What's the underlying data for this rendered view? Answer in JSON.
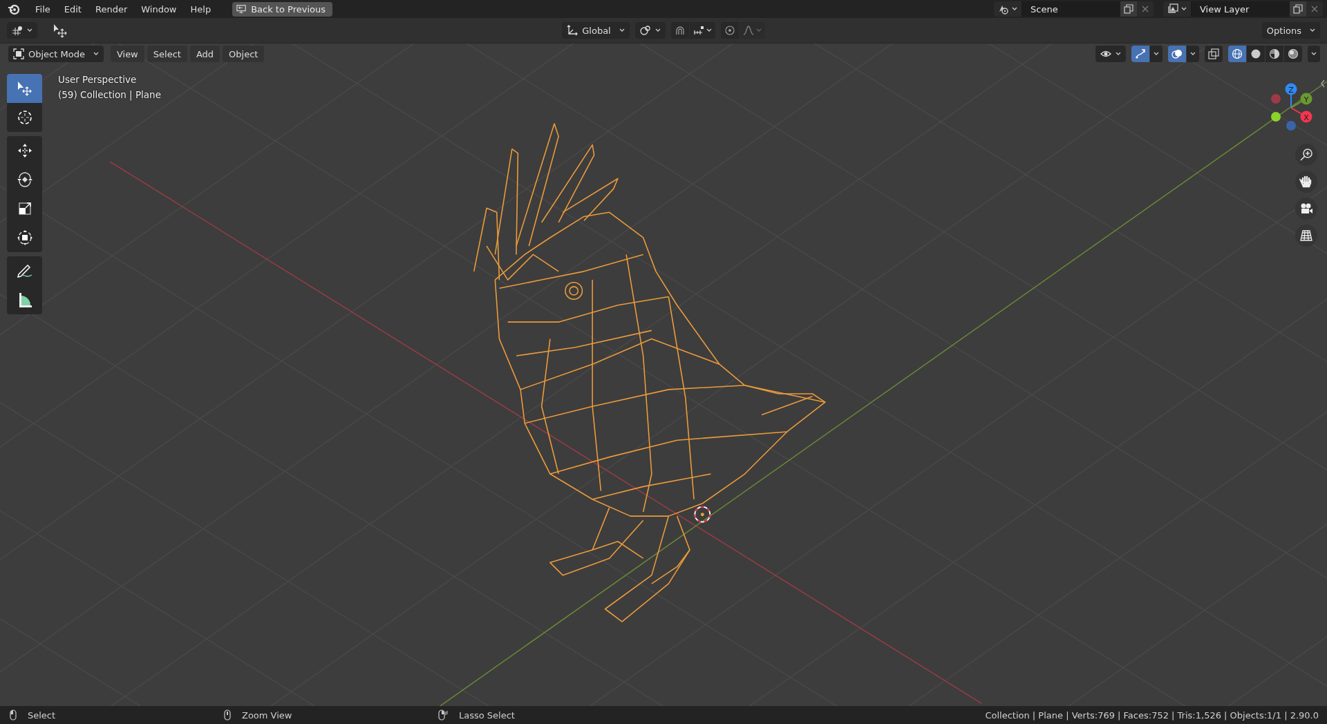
{
  "menubar": {
    "items": [
      {
        "label": "File"
      },
      {
        "label": "Edit"
      },
      {
        "label": "Render"
      },
      {
        "label": "Window"
      },
      {
        "label": "Help"
      }
    ],
    "back_button": "Back to Previous"
  },
  "scene": {
    "name": "Scene"
  },
  "view_layer": {
    "name": "View Layer"
  },
  "tool_header": {
    "orientation": "Global",
    "snap": {
      "on": false
    },
    "proportional_editing": {
      "on": false
    },
    "options": "Options"
  },
  "viewport_header": {
    "mode": "Object Mode",
    "menus": [
      {
        "label": "View"
      },
      {
        "label": "Select"
      },
      {
        "label": "Add"
      },
      {
        "label": "Object"
      }
    ],
    "gizmos": {
      "on": true
    },
    "overlays": {
      "on": true
    },
    "xray": {
      "on": false
    },
    "shading": [
      {
        "kind": "wireframe",
        "selected": true
      },
      {
        "kind": "solid",
        "selected": false
      },
      {
        "kind": "material",
        "selected": false
      },
      {
        "kind": "rendered",
        "selected": false
      }
    ]
  },
  "overlay_text": {
    "view_name": "User Perspective",
    "object_info": "(59) Collection | Plane"
  },
  "toolbar": {
    "groups": [
      {
        "tools": [
          {
            "kind": "select",
            "selected": true
          },
          {
            "kind": "cursor",
            "selected": false
          }
        ]
      },
      {
        "tools": [
          {
            "kind": "move",
            "selected": false
          },
          {
            "kind": "rotate",
            "selected": false
          },
          {
            "kind": "scale",
            "selected": false
          },
          {
            "kind": "transform",
            "selected": false
          }
        ]
      },
      {
        "tools": [
          {
            "kind": "annotate",
            "selected": false
          },
          {
            "kind": "measure",
            "selected": false
          }
        ]
      }
    ]
  },
  "gizmo": {
    "axes": [
      {
        "label": "X",
        "color": "#f5364e"
      },
      {
        "label": "Y",
        "color": "#6a9a2f"
      },
      {
        "label": "Z",
        "color": "#2f8af5"
      }
    ]
  },
  "status_bar": {
    "hints": [
      {
        "kind": "left-click",
        "label": "Select"
      },
      {
        "kind": "middle-click",
        "label": "Zoom View"
      },
      {
        "kind": "right-drag",
        "label": "Lasso Select"
      }
    ],
    "stats": "Collection | Plane | Verts:769 | Faces:752 | Tris:1,526 | Objects:1/1 | 2.90.0"
  }
}
